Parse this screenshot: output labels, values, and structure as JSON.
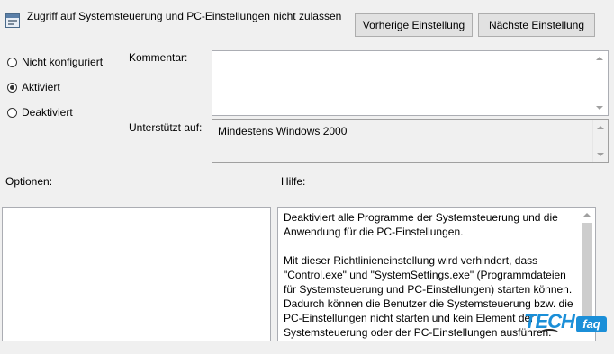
{
  "header": {
    "title": "Zugriff auf Systemsteuerung und PC-Einstellungen nicht zulassen",
    "prev_button": "Vorherige Einstellung",
    "next_button": "Nächste Einstellung",
    "icon": "policy-setting-icon"
  },
  "state": {
    "options": [
      {
        "label": "Nicht konfiguriert",
        "checked": false
      },
      {
        "label": "Aktiviert",
        "checked": true
      },
      {
        "label": "Deaktiviert",
        "checked": false
      }
    ]
  },
  "comment": {
    "label": "Kommentar:",
    "value": ""
  },
  "supported": {
    "label": "Unterstützt auf:",
    "value": "Mindestens Windows 2000"
  },
  "options_section": {
    "label": "Optionen:"
  },
  "help_section": {
    "label": "Hilfe:",
    "paragraphs": [
      "Deaktiviert alle Programme der Systemsteuerung und die Anwendung für die PC-Einstellungen.",
      "Mit dieser Richtlinieneinstellung wird verhindert, dass \"Control.exe\" und \"SystemSettings.exe\" (Programmdateien für Systemsteuerung und PC-Einstellungen) starten können. Dadurch können die Benutzer die Systemsteuerung bzw. die PC-Einstellungen nicht starten und kein Element der Systemsteuerung oder der PC-Einstellungen ausführen."
    ]
  },
  "watermark": {
    "brand": "TECH",
    "suffix": "faq"
  }
}
